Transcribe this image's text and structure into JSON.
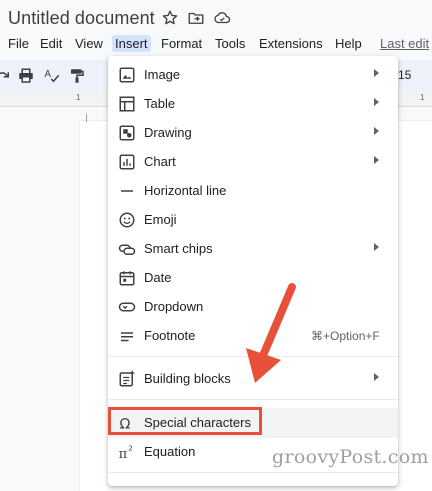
{
  "doc_title": "Untitled document",
  "title_icons": [
    "star-icon",
    "move-to-folder-icon",
    "cloud-status-icon"
  ],
  "menubar": {
    "items": [
      "File",
      "Edit",
      "View",
      "Insert",
      "Format",
      "Tools",
      "Extensions",
      "Help"
    ],
    "active": "Insert",
    "last_edit": "Last edit"
  },
  "toolbar": {
    "icons": [
      "redo-icon",
      "print-icon",
      "spellcheck-icon",
      "paint-format-icon"
    ],
    "font_size_partial": "15"
  },
  "ruler": {
    "marks": [
      "1",
      "1"
    ]
  },
  "insert_menu": {
    "items": [
      {
        "label": "Image",
        "icon": "image-icon",
        "submenu": true
      },
      {
        "label": "Table",
        "icon": "table-icon",
        "submenu": true
      },
      {
        "label": "Drawing",
        "icon": "drawing-icon",
        "submenu": true
      },
      {
        "label": "Chart",
        "icon": "chart-icon",
        "submenu": true
      },
      {
        "label": "Horizontal line",
        "icon": "horizontal-line-icon",
        "submenu": false
      },
      {
        "label": "Emoji",
        "icon": "emoji-icon",
        "submenu": false
      },
      {
        "label": "Smart chips",
        "icon": "smart-chips-icon",
        "submenu": true
      },
      {
        "label": "Date",
        "icon": "calendar-icon",
        "submenu": false
      },
      {
        "label": "Dropdown",
        "icon": "dropdown-icon",
        "submenu": false
      },
      {
        "label": "Footnote",
        "icon": "footnote-icon",
        "submenu": false,
        "shortcut": "⌘+Option+F"
      },
      {
        "label": "Building blocks",
        "icon": "building-blocks-icon",
        "submenu": true
      },
      {
        "label": "Special characters",
        "icon": "omega-icon",
        "submenu": false,
        "highlighted": true
      },
      {
        "label": "Equation",
        "icon": "pi-squared-icon",
        "submenu": false
      }
    ]
  },
  "annotation": {
    "highlight_color": "#e8503a",
    "arrow_color": "#e8503a"
  },
  "watermark": "groovyPost.com"
}
